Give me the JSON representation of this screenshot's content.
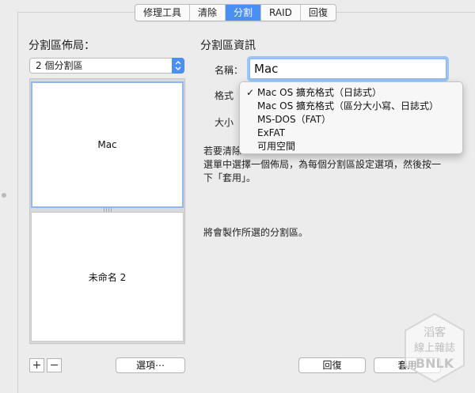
{
  "tabs": [
    {
      "label": "修理工具",
      "active": false
    },
    {
      "label": "清除",
      "active": false
    },
    {
      "label": "分割",
      "active": true
    },
    {
      "label": "RAID",
      "active": false
    },
    {
      "label": "回復",
      "active": false
    }
  ],
  "left": {
    "title": "分割區佈局：",
    "layout_select": "2 個分割區",
    "partitions": [
      "Mac",
      "未命名 2"
    ],
    "add_label": "+",
    "remove_label": "−",
    "options_button": "選項⋯"
  },
  "right": {
    "title": "分割區資訊",
    "name_label": "名稱：",
    "name_value": "Mac",
    "format_label": "格式",
    "size_label": "大小",
    "help_line1": "若要清除",
    "help_line2": "選單中選擇一個佈局，為每個分割區設定選項，然後按一",
    "help_line3": "下「套用」。",
    "status_text": "將會製作所選的分割區。",
    "revert_button": "回復",
    "apply_button": "套用"
  },
  "format_menu": {
    "items": [
      {
        "label": "Mac OS 擴充格式（日誌式）",
        "checked": true
      },
      {
        "label": "Mac OS 擴充格式（區分大小寫、日誌式）",
        "checked": false
      },
      {
        "label": "MS-DOS（FAT）",
        "checked": false
      },
      {
        "label": "ExFAT",
        "checked": false
      },
      {
        "label": "可用空間",
        "checked": false
      }
    ]
  },
  "watermark": {
    "line1": "滔客",
    "line2": "線上雜誌",
    "brand": "BNLK"
  },
  "colors": {
    "accent": "#4a8ff3",
    "selection_border": "#8ab8f6"
  }
}
